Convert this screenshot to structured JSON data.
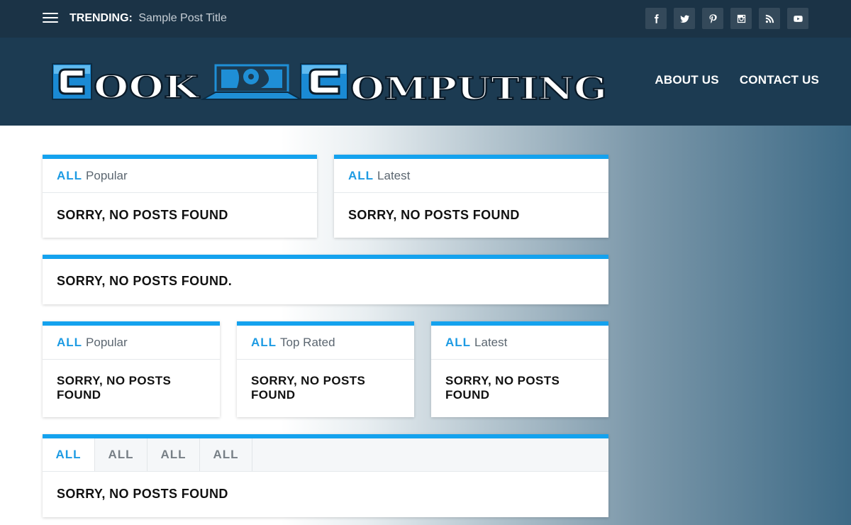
{
  "topbar": {
    "trending_label": "TRENDING:",
    "trending_title": "Sample Post Title",
    "social_icons": [
      "facebook-icon",
      "twitter-icon",
      "pinterest-icon",
      "instagram-icon",
      "rss-icon",
      "youtube-icon"
    ]
  },
  "header": {
    "logo_text": "COOK COMPUTING",
    "nav": [
      "ABOUT US",
      "CONTACT US"
    ]
  },
  "widgets": {
    "w1": {
      "all": "ALL",
      "cat": "Popular",
      "message": "SORRY, NO POSTS FOUND"
    },
    "w2": {
      "all": "ALL",
      "cat": "Latest",
      "message": "SORRY, NO POSTS FOUND"
    },
    "w3": {
      "message": "SORRY, NO POSTS FOUND."
    },
    "w4": {
      "all": "ALL",
      "cat": "Popular",
      "message_line1": "SORRY, NO POSTS",
      "message_line2": "FOUND"
    },
    "w5": {
      "all": "ALL",
      "cat": "Top Rated",
      "message_line1": "SORRY, NO POSTS",
      "message_line2": "FOUND"
    },
    "w6": {
      "all": "ALL",
      "cat": "Latest",
      "message_line1": "SORRY, NO POSTS",
      "message_line2": "FOUND"
    },
    "w7": {
      "tabs": [
        "ALL",
        "ALL",
        "ALL",
        "ALL"
      ],
      "message": "SORRY, NO POSTS FOUND"
    }
  },
  "colors": {
    "accent": "#14a2ee",
    "topbar": "#1b3346",
    "header": "#1c3b52"
  }
}
